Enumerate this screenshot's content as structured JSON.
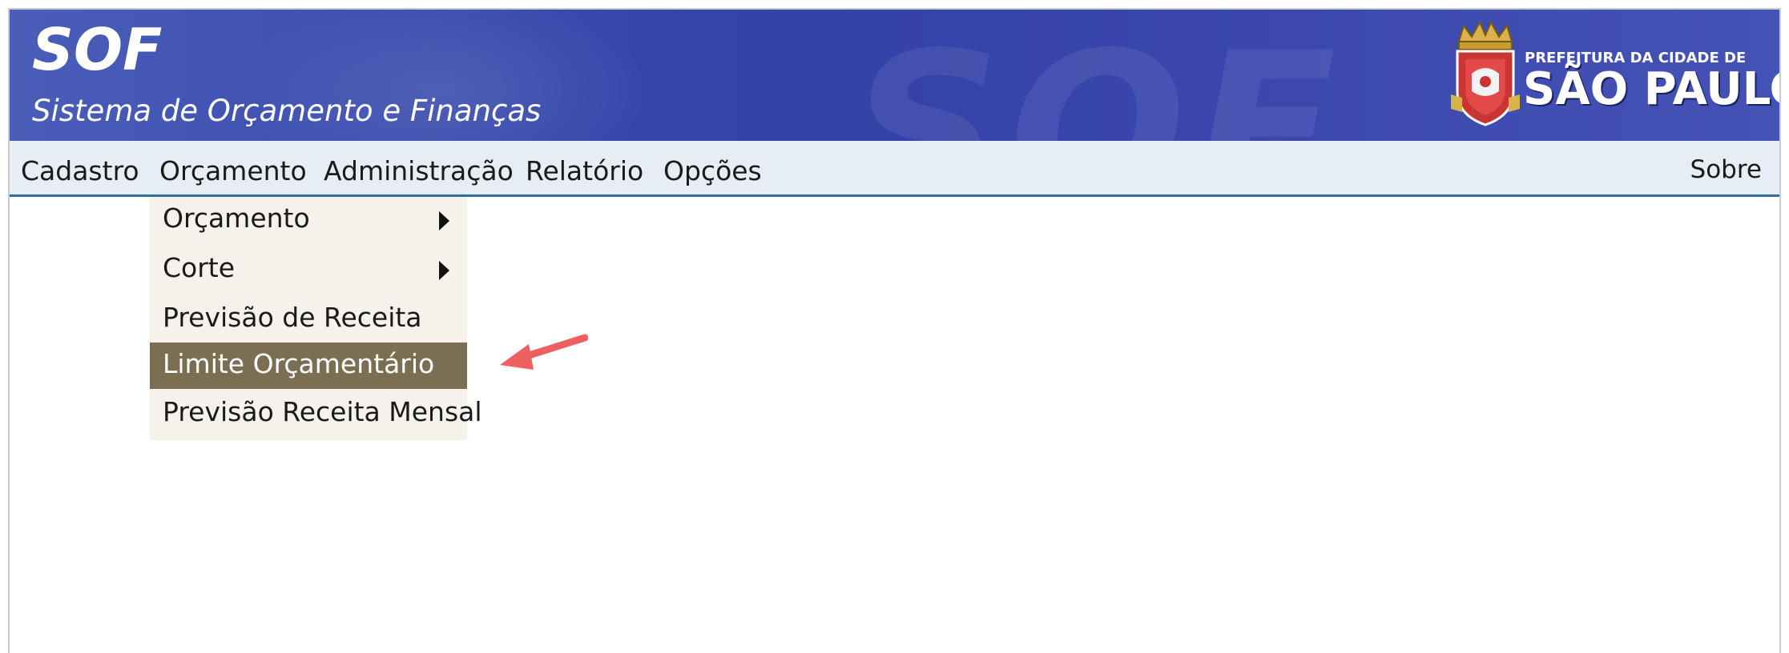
{
  "header": {
    "app_short_name": "SOF",
    "app_full_name": "Sistema de Orçamento e Finanças",
    "background_watermark": "SOF",
    "logo": {
      "line1": "PREFEITURA DA CIDADE DE",
      "line2": "SÃO PAULO",
      "icon": "city-coat-of-arms-icon"
    }
  },
  "menubar": {
    "items": [
      {
        "label": "Cadastro"
      },
      {
        "label": "Orçamento"
      },
      {
        "label": "Administração"
      },
      {
        "label": "Relatório"
      },
      {
        "label": "Opções"
      }
    ],
    "right_item": "Sobre"
  },
  "dropdown": {
    "parent": "Orçamento",
    "items": [
      {
        "label": "Orçamento",
        "has_submenu": true
      },
      {
        "label": "Corte",
        "has_submenu": true
      },
      {
        "label": "Previsão de Receita",
        "has_submenu": false
      },
      {
        "label": "Limite Orçamentário",
        "has_submenu": false,
        "highlighted": true
      },
      {
        "label": "Previsão Receita Mensal",
        "has_submenu": false
      }
    ]
  },
  "colors": {
    "banner": "#3a47ab",
    "menubar": "#e6edf3",
    "menubar_border": "#2f6f9c",
    "dropdown_bg": "#f5f2ec",
    "highlight": "#7b6e52",
    "annotation_arrow": "#ef5f5f"
  }
}
